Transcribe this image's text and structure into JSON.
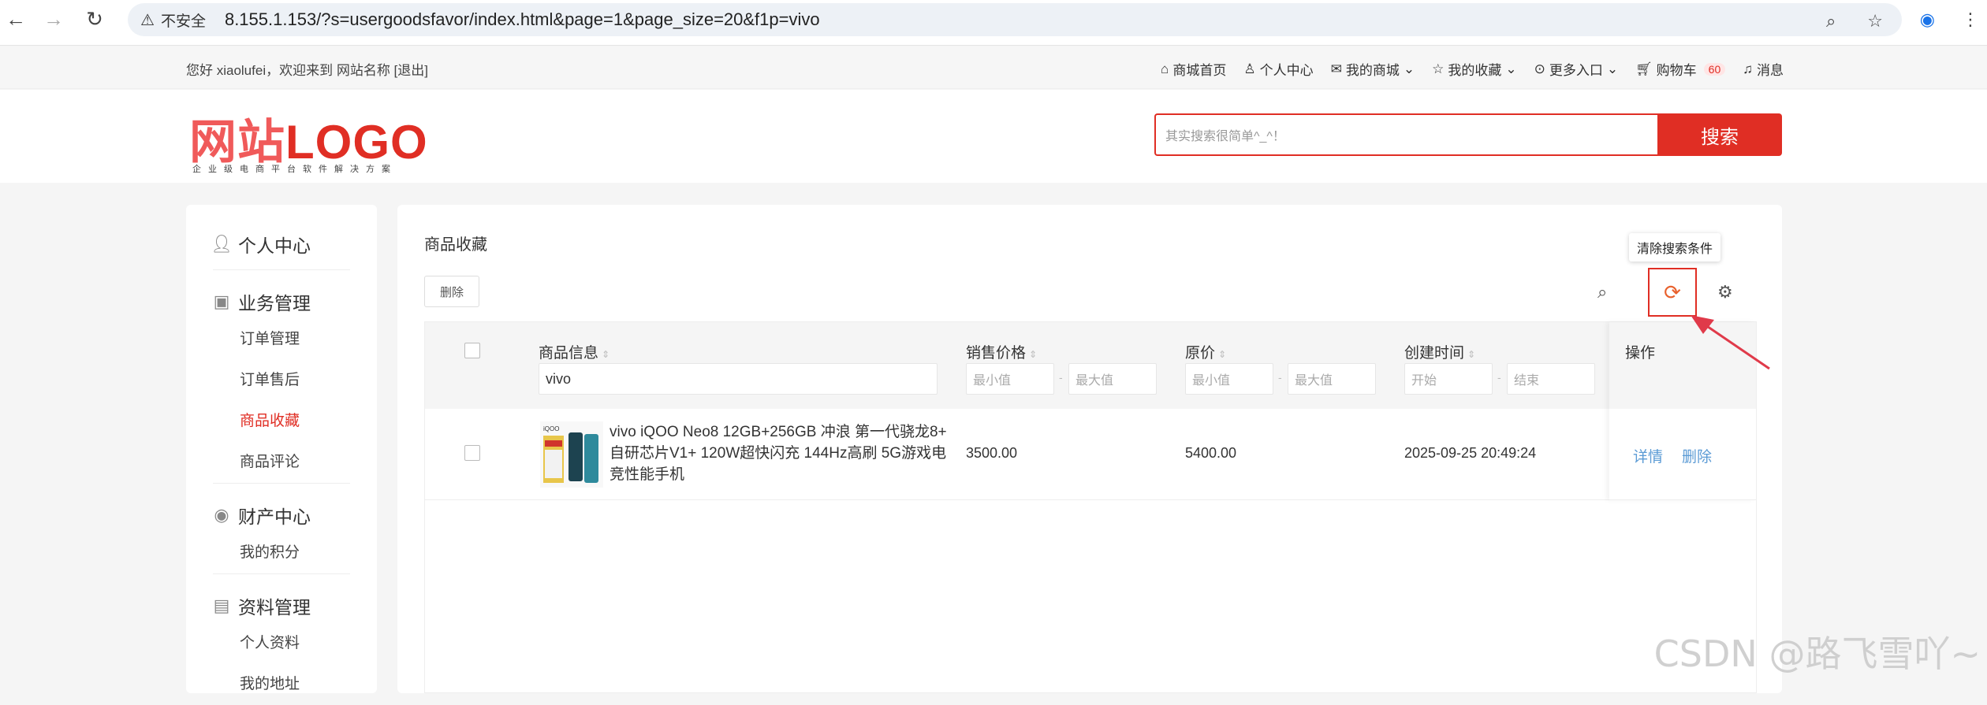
{
  "browser": {
    "security_label": "不安全",
    "url": "8.155.1.153/?s=usergoodsfavor/index.html&page=1&page_size=20&f1p=vivo"
  },
  "topbar": {
    "welcome": "您好 xiaolufei，欢迎来到 网站名称 [退出]",
    "nav": [
      {
        "icon": "home-icon",
        "label": "商城首页"
      },
      {
        "icon": "user-icon",
        "label": "个人中心"
      },
      {
        "icon": "mail-icon",
        "label": "我的商城"
      },
      {
        "icon": "star-icon",
        "label": "我的收藏"
      },
      {
        "icon": "more-icon",
        "label": "更多入口"
      },
      {
        "icon": "cart-icon",
        "label": "购物车"
      }
    ],
    "cart_count": "60",
    "message_label": "消息"
  },
  "header": {
    "logo_cn": "网站",
    "logo_en": "LOGO",
    "logo_sub": "企业级电商平台软件解决方案",
    "search_placeholder": "其实搜索很简单^_^！",
    "search_button": "搜索"
  },
  "sidebar": {
    "personal_center": "个人中心",
    "business": "业务管理",
    "business_items": [
      "订单管理",
      "订单售后",
      "商品收藏",
      "商品评论"
    ],
    "finance": "财产中心",
    "finance_items": [
      "我的积分"
    ],
    "profile": "资料管理",
    "profile_items": [
      "个人资料",
      "我的地址"
    ]
  },
  "main": {
    "title": "商品收藏",
    "delete_button": "删除",
    "tooltip": "清除搜索条件",
    "columns": {
      "goods": "商品信息",
      "price": "销售价格",
      "original_price": "原价",
      "created": "创建时间",
      "actions": "操作"
    },
    "filters": {
      "goods_value": "vivo",
      "min": "最小值",
      "max": "最大值",
      "start": "开始",
      "end": "结束",
      "dash": "-"
    },
    "rows": [
      {
        "name": "vivo iQOO Neo8 12GB+256GB 冲浪 第一代骁龙8+ 自研芯片V1+ 120W超快闪充 144Hz高刷 5G游戏电竞性能手机",
        "price": "3500.00",
        "original_price": "5400.00",
        "created": "2025-09-25 20:49:24",
        "detail": "详情",
        "delete": "删除"
      }
    ]
  },
  "watermark": "CSDN @路飞雪吖~"
}
